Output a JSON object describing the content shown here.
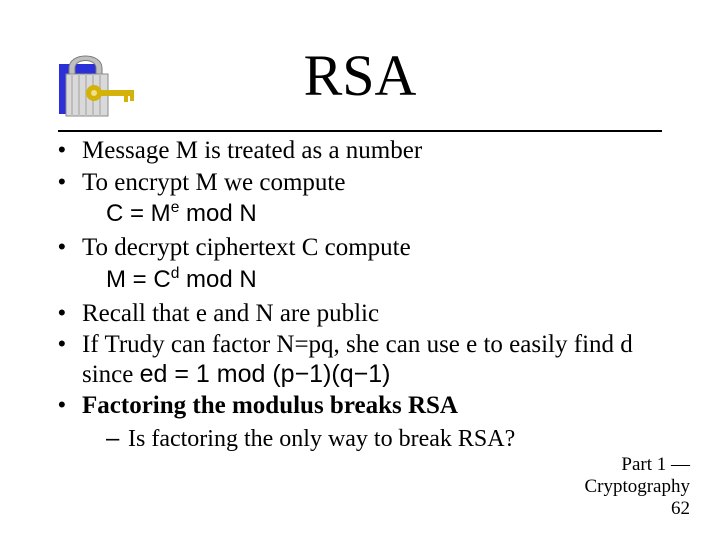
{
  "slide": {
    "title": "RSA",
    "bullets": [
      {
        "text": "Message M is treated as a number"
      },
      {
        "text": "To encrypt M we compute"
      },
      {
        "sub": "C = M<sup>e</sup> mod N",
        "kind": "formula"
      },
      {
        "text": "To decrypt ciphertext C compute"
      },
      {
        "sub": "M = C<sup>d</sup> mod N",
        "kind": "formula"
      },
      {
        "text": "Recall that e and N are public"
      },
      {
        "text": "If Trudy can factor N=pq, she can use e to easily find d since <span class='sans'>ed = 1 mod (p&minus;1)(q&minus;1)</span>"
      },
      {
        "text": "Factoring the modulus breaks RSA",
        "bold": true
      },
      {
        "dash": "Is factoring the only way to break RSA?"
      }
    ]
  },
  "footer": {
    "line1": "Part 1 —",
    "line2": "Cryptography",
    "page": "62"
  }
}
